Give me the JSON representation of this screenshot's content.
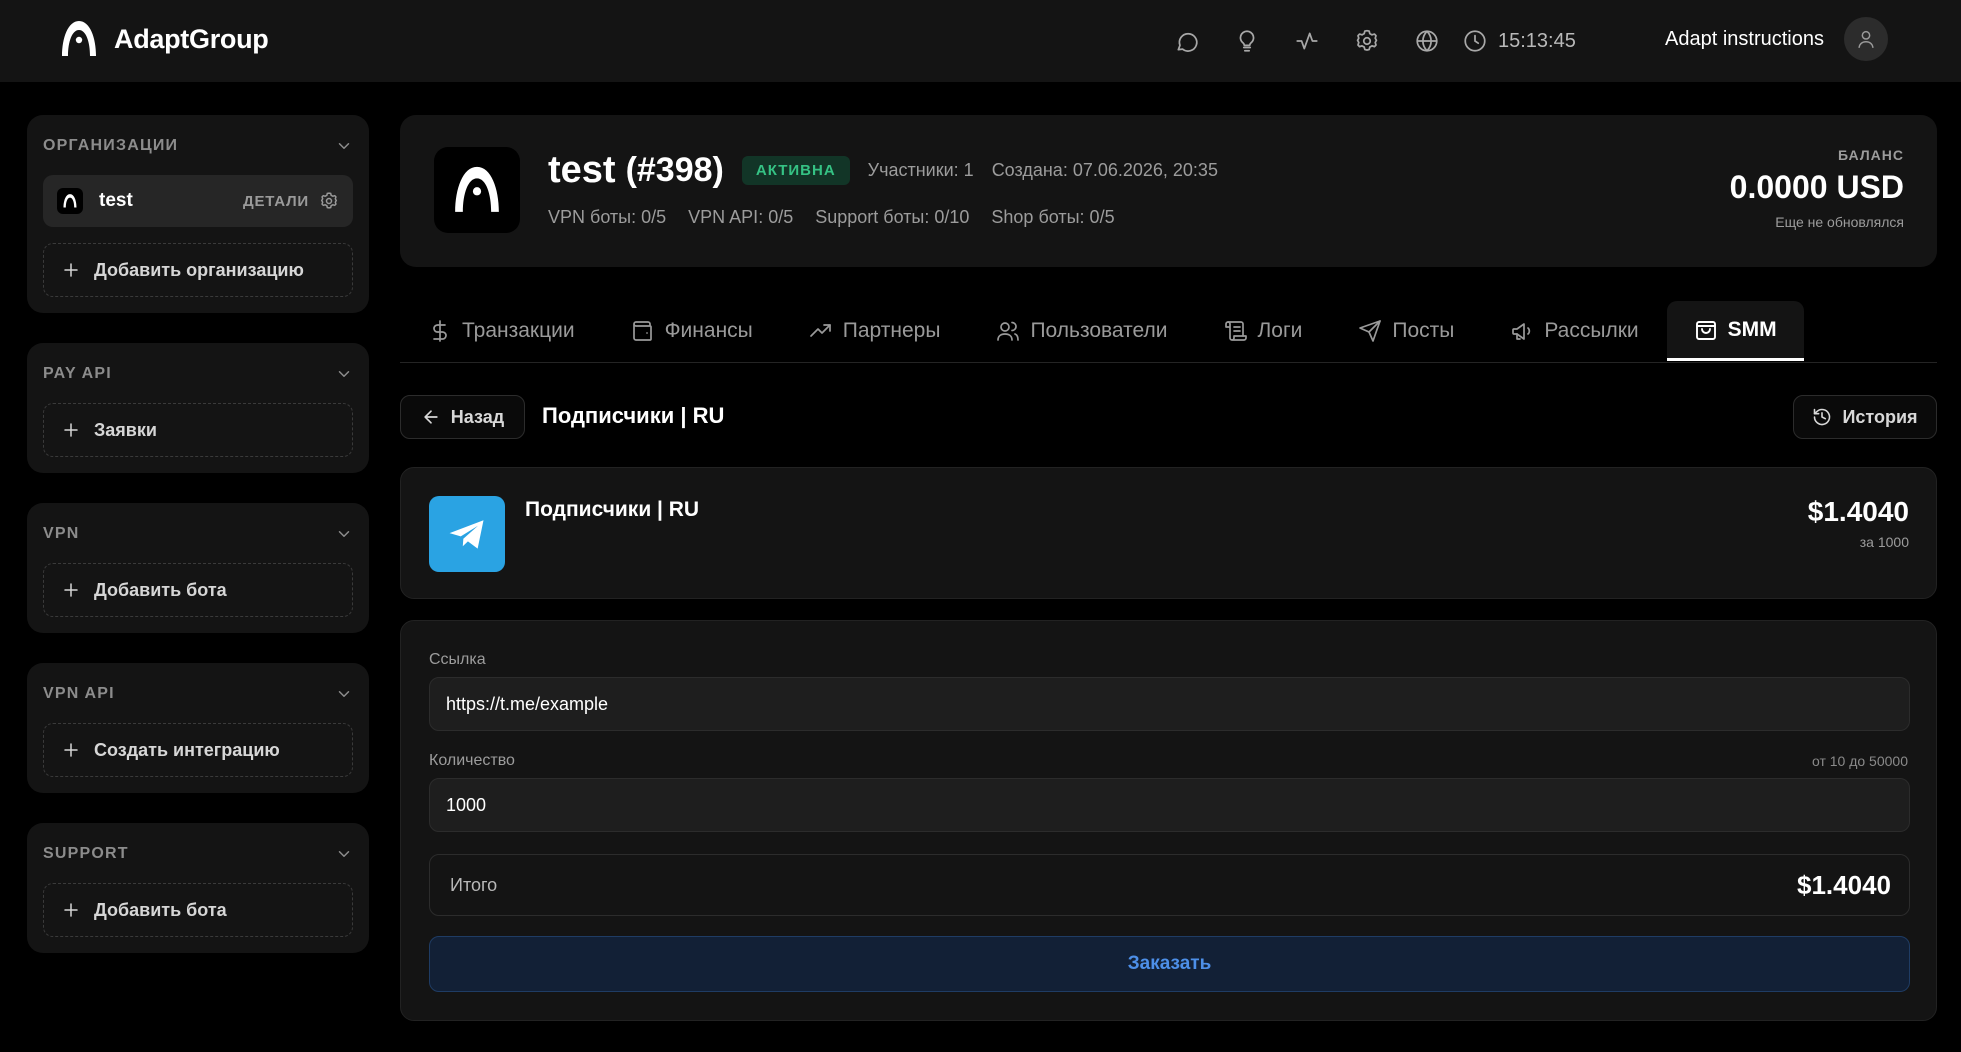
{
  "brand": {
    "name": "AdaptGroup"
  },
  "topbar": {
    "icons": [
      "chat-icon",
      "lightbulb-icon",
      "activity-icon",
      "gear-icon",
      "globe-icon"
    ],
    "time": "15:13:45",
    "user_name": "Adapt instructions"
  },
  "sidebar": {
    "organizations": {
      "title": "ОРГАНИЗАЦИИ",
      "item_name": "test",
      "item_details": "ДЕТАЛИ",
      "add_label": "Добавить организацию"
    },
    "pay_api": {
      "title": "PAY API",
      "add_label": "Заявки"
    },
    "vpn": {
      "title": "VPN",
      "add_label": "Добавить бота"
    },
    "vpn_api": {
      "title": "VPN API",
      "add_label": "Создать интеграцию"
    },
    "support": {
      "title": "SUPPORT",
      "add_label": "Добавить бота"
    }
  },
  "org": {
    "name": "test",
    "id": "(#398)",
    "status": "АКТИВНА",
    "members": "Участники: 1",
    "created": "Создана: 07.06.2026, 20:35",
    "limits": [
      "VPN боты: 0/5",
      "VPN API: 0/5",
      "Support боты: 0/10",
      "Shop боты: 0/5"
    ],
    "balance_label": "БАЛАНС",
    "balance_value": "0.0000 USD",
    "balance_note": "Еще не обновлялся"
  },
  "tabs": [
    {
      "label": "Транзакции",
      "icon": "dollar-icon"
    },
    {
      "label": "Финансы",
      "icon": "wallet-icon"
    },
    {
      "label": "Партнеры",
      "icon": "trending-up-icon"
    },
    {
      "label": "Пользователи",
      "icon": "users-icon"
    },
    {
      "label": "Логи",
      "icon": "scroll-icon"
    },
    {
      "label": "Посты",
      "icon": "send-icon"
    },
    {
      "label": "Рассылки",
      "icon": "megaphone-icon"
    },
    {
      "label": "SMM",
      "icon": "shopping-bag-icon",
      "active": true
    }
  ],
  "subheader": {
    "back_label": "Назад",
    "title": "Подписчики | RU",
    "history_label": "История"
  },
  "product": {
    "name": "Подписчики | RU",
    "price": "$1.4040",
    "unit": "за 1000"
  },
  "form": {
    "link_label": "Ссылка",
    "link_value": "https://t.me/example",
    "qty_label": "Количество",
    "qty_hint": "от 10 до 50000",
    "qty_value": "1000",
    "total_label": "Итого",
    "total_value": "$1.4040",
    "order_label": "Заказать"
  },
  "colors": {
    "background": "#000000",
    "panel": "#141414",
    "active_badge_text": "#35c284",
    "telegram": "#2aa3e3",
    "order_button_text": "#4d8fe8"
  }
}
